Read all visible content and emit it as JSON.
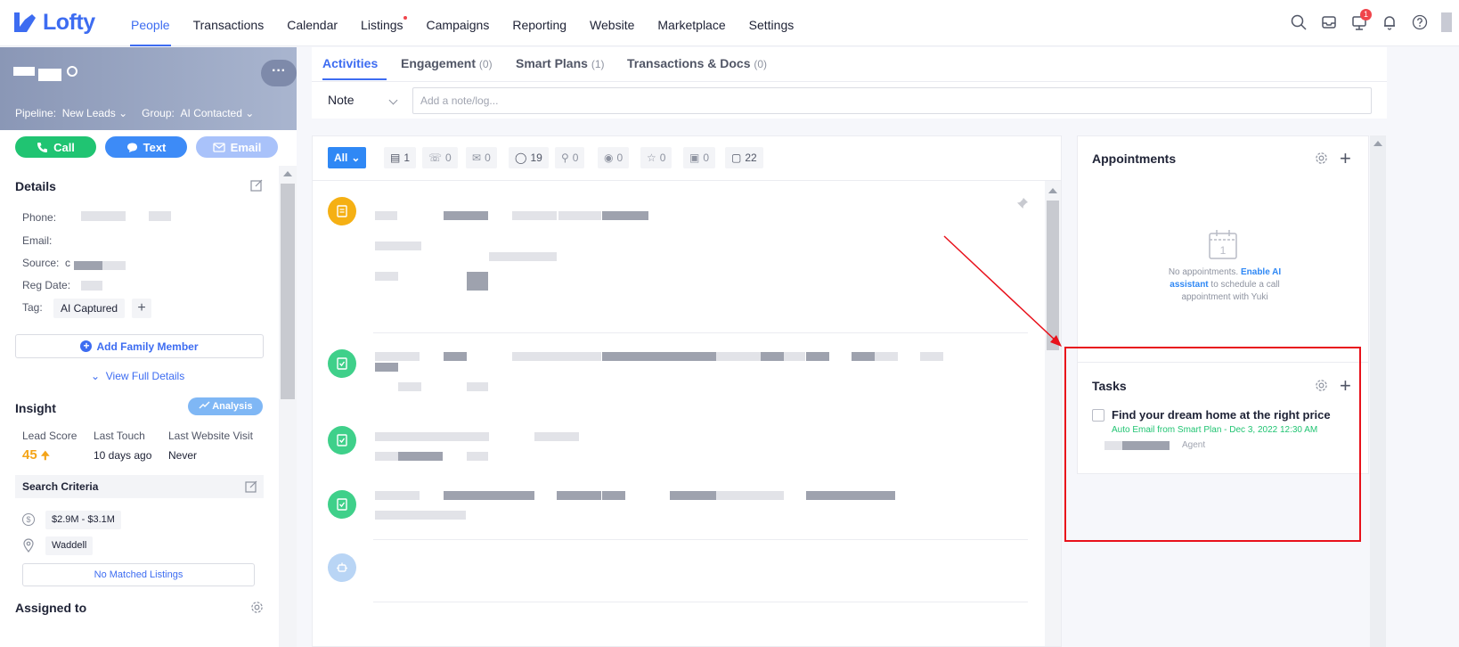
{
  "app": {
    "logo_text": "Lofty"
  },
  "nav": {
    "items": [
      "People",
      "Transactions",
      "Calendar",
      "Listings",
      "Campaigns",
      "Reporting",
      "Website",
      "Marketplace",
      "Settings"
    ],
    "notification_badge": "1"
  },
  "lead": {
    "pipeline_label": "Pipeline:",
    "pipeline_value": "New Leads",
    "group_label": "Group:",
    "group_value": "AI Contacted",
    "more": "···"
  },
  "actions": {
    "call": "Call",
    "text": "Text",
    "email": "Email"
  },
  "details": {
    "title": "Details",
    "phone_label": "Phone:",
    "email_label": "Email:",
    "source_label": "Source:",
    "source_value": "c",
    "reg_date_label": "Reg Date:",
    "tag_label": "Tag:",
    "tag_value": "AI Captured",
    "tag_add": "+",
    "add_family": "Add Family Member",
    "view_full": "View Full Details"
  },
  "insight": {
    "title": "Insight",
    "analysis": "Analysis",
    "lead_score_label": "Lead Score",
    "lead_score_value": "45",
    "last_touch_label": "Last Touch",
    "last_touch_value": "10 days ago",
    "last_visit_label": "Last Website Visit",
    "last_visit_value": "Never"
  },
  "search_criteria": {
    "title": "Search Criteria",
    "price": "$2.9M - $3.1M",
    "location": "Waddell",
    "no_matched": "No Matched Listings"
  },
  "assigned": {
    "title": "Assigned to"
  },
  "tabs": [
    {
      "label": "Activities",
      "count": ""
    },
    {
      "label": "Engagement",
      "count": "(0)"
    },
    {
      "label": "Smart Plans",
      "count": "(1)"
    },
    {
      "label": "Transactions & Docs",
      "count": "(0)"
    }
  ],
  "note": {
    "type": "Note",
    "placeholder": "Add a note/log..."
  },
  "filters": {
    "all": "All",
    "counts": [
      "1",
      "0",
      "0",
      "19",
      "0",
      "0",
      "0",
      "0",
      "22"
    ]
  },
  "appointments": {
    "title": "Appointments",
    "calendar_day": "1",
    "empty_text": "No appointments.",
    "link_text": "Enable AI assistant",
    "empty_tail": "to schedule a call appointment with Yuki"
  },
  "tasks": {
    "title": "Tasks",
    "item_title": "Find your dream home at the right price",
    "item_sub": "Auto Email from Smart Plan - Dec 3, 2022 12:30 AM",
    "item_role": "Agent"
  },
  "colors": {
    "brand": "#3d6cf1",
    "call": "#20c472",
    "highlight": "#e8111b"
  }
}
